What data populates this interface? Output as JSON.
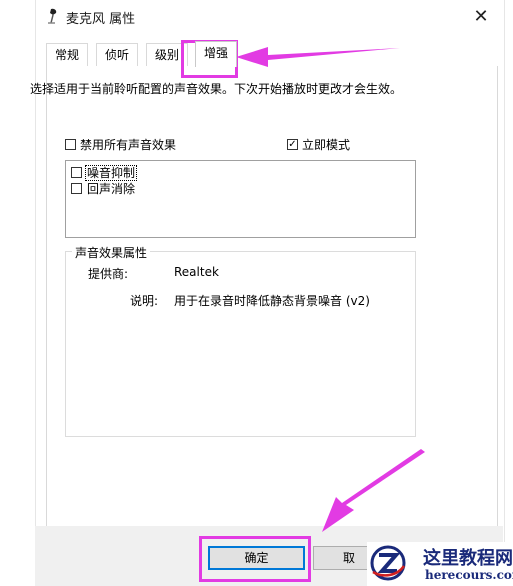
{
  "window": {
    "title": "麦克风 属性",
    "close_glyph": "✕"
  },
  "tabs": [
    {
      "label": "常规"
    },
    {
      "label": "侦听"
    },
    {
      "label": "级别"
    },
    {
      "label": "增强",
      "active": true
    }
  ],
  "enhancements": {
    "description": "选择适用于当前聆听配置的声音效果。下次开始播放时更改才会生效。",
    "disable_all": {
      "label": "禁用所有声音效果",
      "checked": false
    },
    "immediate_mode": {
      "label": "立即模式",
      "checked": true,
      "check_glyph": "✓"
    },
    "effects": [
      {
        "label": "噪音抑制",
        "checked": false,
        "selected": true
      },
      {
        "label": "回声消除",
        "checked": false,
        "selected": false
      }
    ],
    "properties": {
      "title": "声音效果属性",
      "provider_label": "提供商:",
      "provider_value": "Realtek",
      "description_label": "说明:",
      "description_value": "用于在录音时降低静态背景噪音 (v2)"
    }
  },
  "buttons": {
    "ok_label": "确定",
    "cancel_label": "取"
  },
  "annotation_color": "#e23be3",
  "watermark": {
    "title": "这里教程网",
    "url": "herecours.com",
    "accent": "#1a2a7a"
  }
}
